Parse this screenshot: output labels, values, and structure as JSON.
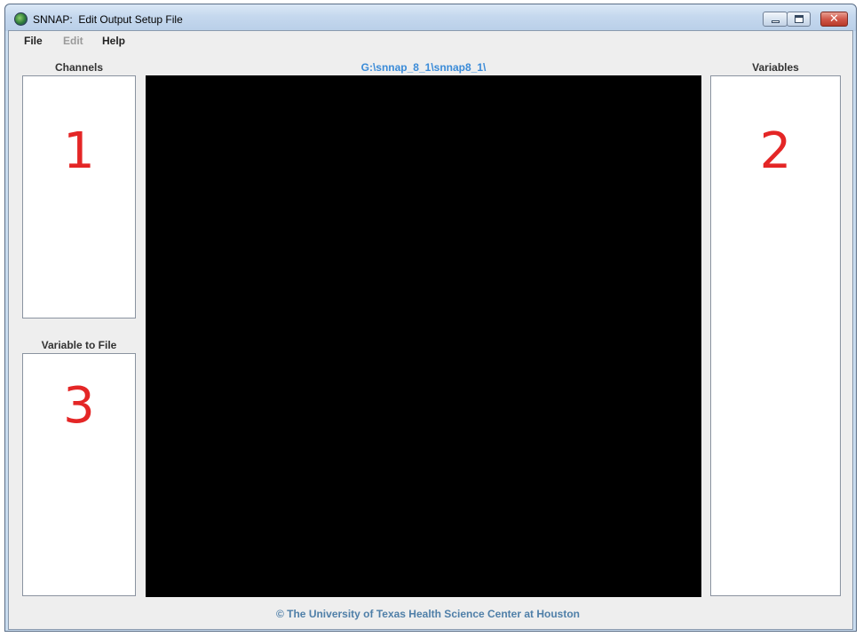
{
  "window": {
    "title": "SNNAP:  Edit Output Setup File",
    "controls": {
      "minimize_icon": "minimize-icon",
      "maximize_icon": "maximize-icon",
      "close_icon": "close-icon",
      "close_glyph": "✕"
    }
  },
  "menu": {
    "file": "File",
    "edit": "Edit",
    "help": "Help"
  },
  "panels": {
    "channels": {
      "label": "Channels",
      "annotation": "1"
    },
    "variables": {
      "label": "Variables",
      "annotation": "2"
    },
    "variable_to_file": {
      "label": "Variable to File",
      "annotation": "3"
    }
  },
  "canvas": {
    "path": "G:\\snnap_8_1\\snnap8_1\\",
    "background": "#000000"
  },
  "footer": {
    "copyright": "© The University of Texas Health Science Center at Houston"
  },
  "colors": {
    "path_text": "#3a8bd8",
    "footer_text": "#4f7fa8",
    "annotation": "#e42626"
  }
}
